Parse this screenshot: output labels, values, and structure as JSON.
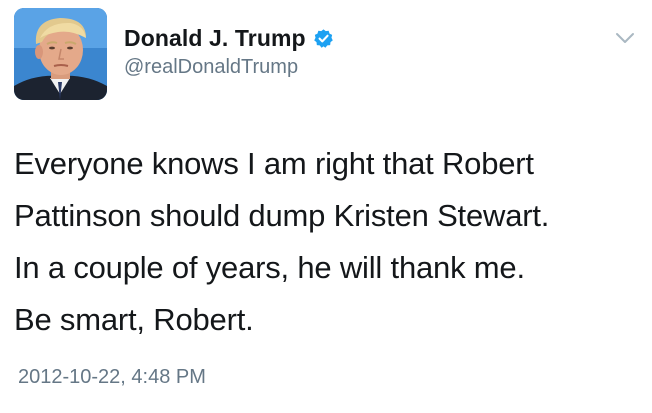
{
  "author": {
    "display_name": "Donald J. Trump",
    "handle": "@realDonaldTrump",
    "verified": true,
    "avatar": "profile-photo"
  },
  "tweet": {
    "lines": [
      "Everyone knows I am right that Robert",
      "Pattinson should dump Kristen Stewart.",
      "In a couple of years, he will thank me.",
      "Be smart, Robert."
    ],
    "timestamp": "2012-10-22, 4:48 PM"
  },
  "icons": {
    "verified": "verified-badge-icon",
    "menu": "chevron-down-icon"
  },
  "colors": {
    "text": "#14171a",
    "secondary_text": "#657786",
    "verified_blue": "#1da1f2",
    "background": "#ffffff"
  }
}
